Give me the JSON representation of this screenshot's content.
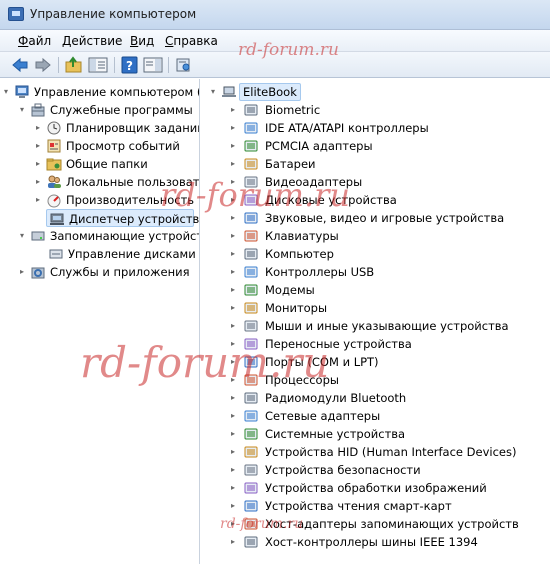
{
  "window": {
    "title": "Управление компьютером"
  },
  "menu": [
    {
      "accel": "Ф",
      "rest": "айл"
    },
    {
      "accel": "Д",
      "rest": "ействие"
    },
    {
      "accel": "В",
      "rest": "ид"
    },
    {
      "accel": "С",
      "rest": "правка"
    }
  ],
  "toolbar": {
    "icons": [
      "back-arrow-icon",
      "forward-arrow-icon",
      "up-folder-icon",
      "show-hide-tree-icon",
      "help-icon",
      "action-pane-icon",
      "properties-icon"
    ]
  },
  "watermark": [
    "rd-forum.ru",
    "rd-forum.ru",
    "rd-forum.ru",
    "rd-forum.ru"
  ],
  "left_tree": {
    "root": "Управление компьютером (л",
    "items": [
      "Служебные программы",
      "Планировщик заданий",
      "Просмотр событий",
      "Общие папки",
      "Локальные пользовате",
      "Производительность",
      "Диспетчер устройств",
      "Запоминающие устройст",
      "Управление дисками",
      "Службы и приложения"
    ],
    "selected": "Диспетчер устройств"
  },
  "device_tree": {
    "root": "EliteBook",
    "categories": [
      "Biometric",
      "IDE ATA/ATAPI контроллеры",
      "PCMCIA адаптеры",
      "Батареи",
      "Видеоадаптеры",
      "Дисковые устройства",
      "Звуковые, видео и игровые устройства",
      "Клавиатуры",
      "Компьютер",
      "Контроллеры USB",
      "Модемы",
      "Мониторы",
      "Мыши и иные указывающие устройства",
      "Переносные устройства",
      "Порты (COM и LPT)",
      "Процессоры",
      "Радиомодули Bluetooth",
      "Сетевые адаптеры",
      "Системные устройства",
      "Устройства HID (Human Interface Devices)",
      "Устройства безопасности",
      "Устройства обработки изображений",
      "Устройства чтения смарт-карт",
      "Хост-адаптеры запоминающих устройств",
      "Хост-контроллеры шины IEEE 1394"
    ]
  },
  "colors": {
    "selection": "#dcebfc",
    "titlebar": "#c4d7ee",
    "watermark": "#c82828"
  }
}
